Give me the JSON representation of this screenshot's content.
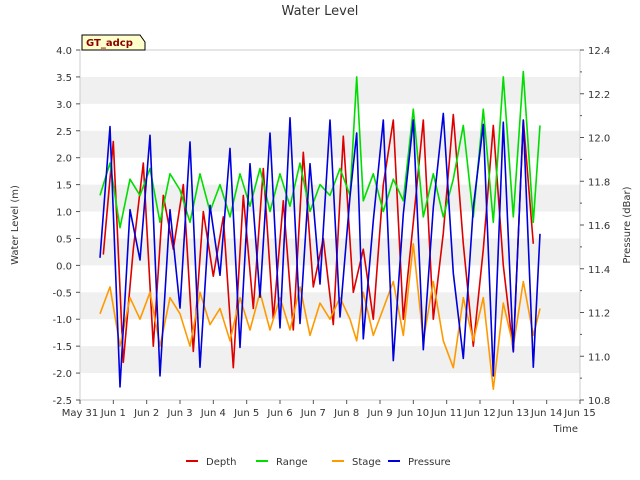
{
  "chart_data": {
    "type": "line",
    "title": "Water Level",
    "site_badge": "GT_adcp",
    "xlabel": "Time",
    "ylabel_left": "Water Level (m)",
    "ylabel_right": "Pressure (dBar)",
    "x_tick_labels": [
      "May 31",
      "Jun 1",
      "Jun 2",
      "Jun 3",
      "Jun 4",
      "Jun 5",
      "Jun 6",
      "Jun 7",
      "Jun 8",
      "Jun 9",
      "Jun 10",
      "Jun 11",
      "Jun 12",
      "Jun 13",
      "Jun 14",
      "Jun 15"
    ],
    "x_range_days": [
      0,
      15
    ],
    "ylim_left": [
      -2.5,
      4.0
    ],
    "y_ticks_left": [
      "-2.5",
      "-2.0",
      "-1.5",
      "-1.0",
      "-0.5",
      "0.0",
      "0.5",
      "1.0",
      "1.5",
      "2.0",
      "2.5",
      "3.0",
      "3.5",
      "4.0"
    ],
    "ylim_right": [
      10.8,
      12.4
    ],
    "y_ticks_right": [
      "10.8",
      "11.0",
      "11.2",
      "11.4",
      "11.6",
      "11.8",
      "12.0",
      "12.2",
      "12.4"
    ],
    "grid": "alternating horizontal bands",
    "legend_position": "bottom",
    "series": [
      {
        "name": "Depth",
        "color": "#dd0000",
        "axis": "left",
        "x": [
          0.7,
          1.0,
          1.3,
          1.6,
          1.9,
          2.2,
          2.5,
          2.8,
          3.1,
          3.4,
          3.7,
          4.0,
          4.3,
          4.6,
          4.9,
          5.2,
          5.5,
          5.8,
          6.1,
          6.4,
          6.7,
          7.0,
          7.3,
          7.6,
          7.9,
          8.2,
          8.5,
          8.8,
          9.1,
          9.4,
          9.7,
          10.0,
          10.3,
          10.6,
          10.9,
          11.2,
          11.5,
          11.8,
          12.1,
          12.4,
          12.7,
          13.0,
          13.3,
          13.6
        ],
        "y": [
          0.2,
          2.3,
          -1.8,
          0.3,
          1.9,
          -1.5,
          1.3,
          0.3,
          1.5,
          -1.6,
          1.0,
          -0.2,
          0.9,
          -1.9,
          1.3,
          -0.8,
          1.8,
          -1.0,
          1.2,
          -1.2,
          2.1,
          -0.4,
          0.5,
          -1.1,
          2.4,
          -0.5,
          0.3,
          -1.0,
          1.5,
          2.7,
          -1.0,
          0.8,
          2.7,
          -1.0,
          0.6,
          2.8,
          0.4,
          -1.5,
          0.3,
          2.6,
          0.0,
          -1.6,
          2.7,
          0.4
        ]
      },
      {
        "name": "Range",
        "color": "#00dd00",
        "axis": "left",
        "x": [
          0.6,
          0.9,
          1.2,
          1.5,
          1.8,
          2.1,
          2.4,
          2.7,
          3.0,
          3.3,
          3.6,
          3.9,
          4.2,
          4.5,
          4.8,
          5.1,
          5.4,
          5.7,
          6.0,
          6.3,
          6.6,
          6.9,
          7.2,
          7.5,
          7.8,
          8.1,
          8.3,
          8.5,
          8.8,
          9.1,
          9.4,
          9.7,
          10.0,
          10.3,
          10.6,
          10.9,
          11.2,
          11.5,
          11.8,
          12.1,
          12.4,
          12.7,
          13.0,
          13.3,
          13.6,
          13.8
        ],
        "y": [
          1.3,
          1.9,
          0.7,
          1.6,
          1.3,
          1.8,
          0.8,
          1.7,
          1.4,
          0.8,
          1.7,
          1.0,
          1.5,
          0.9,
          1.7,
          1.1,
          1.8,
          1.0,
          1.7,
          1.1,
          1.9,
          1.0,
          1.5,
          1.3,
          1.8,
          1.3,
          3.5,
          1.2,
          1.7,
          1.0,
          1.6,
          1.2,
          2.9,
          0.9,
          1.7,
          0.9,
          1.6,
          2.6,
          0.9,
          2.9,
          0.8,
          3.5,
          0.9,
          3.6,
          0.8,
          2.6
        ]
      },
      {
        "name": "Stage",
        "color": "#ff9900",
        "axis": "left",
        "x": [
          0.6,
          0.9,
          1.2,
          1.5,
          1.8,
          2.1,
          2.4,
          2.7,
          3.0,
          3.3,
          3.6,
          3.9,
          4.2,
          4.5,
          4.8,
          5.1,
          5.4,
          5.7,
          6.0,
          6.3,
          6.6,
          6.9,
          7.2,
          7.5,
          7.8,
          8.1,
          8.3,
          8.5,
          8.8,
          9.1,
          9.4,
          9.7,
          10.0,
          10.3,
          10.6,
          10.9,
          11.2,
          11.5,
          11.8,
          12.1,
          12.4,
          12.7,
          13.0,
          13.3,
          13.6,
          13.8
        ],
        "y": [
          -0.9,
          -0.4,
          -1.5,
          -0.6,
          -1.0,
          -0.5,
          -1.5,
          -0.6,
          -0.9,
          -1.5,
          -0.5,
          -1.1,
          -0.8,
          -1.4,
          -0.6,
          -1.2,
          -0.5,
          -1.2,
          -0.6,
          -1.2,
          -0.4,
          -1.3,
          -0.7,
          -1.0,
          -0.6,
          -1.0,
          -1.4,
          -0.5,
          -1.3,
          -0.8,
          -0.3,
          -1.3,
          0.4,
          -1.4,
          -0.3,
          -1.4,
          -1.9,
          -0.6,
          -1.4,
          -0.6,
          -2.3,
          -0.7,
          -1.5,
          -0.3,
          -1.3,
          -0.8
        ]
      },
      {
        "name": "Pressure",
        "color": "#0000dd",
        "axis": "right",
        "x": [
          0.6,
          0.9,
          1.2,
          1.5,
          1.8,
          2.1,
          2.4,
          2.7,
          3.0,
          3.3,
          3.6,
          3.9,
          4.2,
          4.5,
          4.8,
          5.1,
          5.4,
          5.7,
          6.0,
          6.3,
          6.6,
          6.9,
          7.2,
          7.5,
          7.8,
          8.1,
          8.3,
          8.5,
          8.8,
          9.1,
          9.4,
          9.7,
          10.0,
          10.3,
          10.6,
          10.9,
          11.2,
          11.5,
          11.8,
          12.1,
          12.4,
          12.7,
          13.0,
          13.3,
          13.6,
          13.8
        ],
        "y": [
          11.45,
          12.05,
          10.86,
          11.67,
          11.44,
          12.01,
          10.91,
          11.67,
          11.22,
          11.98,
          10.95,
          11.69,
          11.37,
          11.95,
          11.04,
          11.88,
          11.27,
          12.02,
          11.13,
          12.09,
          11.15,
          11.88,
          11.33,
          12.08,
          11.18,
          11.73,
          12.02,
          11.08,
          11.62,
          12.08,
          10.98,
          11.65,
          12.08,
          11.03,
          11.68,
          12.11,
          11.38,
          10.99,
          11.68,
          12.06,
          10.91,
          12.07,
          11.02,
          12.08,
          10.95,
          11.56
        ]
      }
    ]
  }
}
